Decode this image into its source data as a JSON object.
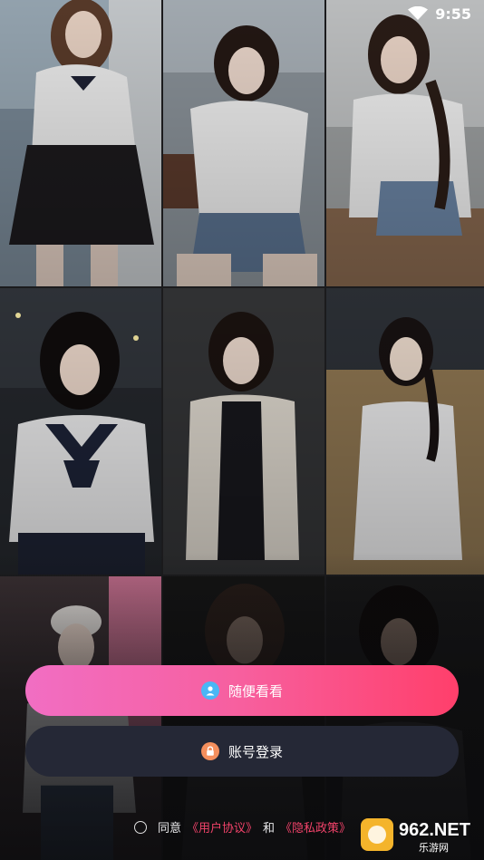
{
  "status_bar": {
    "time": "9:55",
    "wifi_icon": "wifi-icon",
    "battery_icon": "battery-icon"
  },
  "gallery": {
    "tiles": [
      {
        "name": "photo-tile-1",
        "palette": "bright"
      },
      {
        "name": "photo-tile-2",
        "palette": "bright"
      },
      {
        "name": "photo-tile-3",
        "palette": "bright"
      },
      {
        "name": "photo-tile-4",
        "palette": "night"
      },
      {
        "name": "photo-tile-5",
        "palette": "dark"
      },
      {
        "name": "photo-tile-6",
        "palette": "field"
      },
      {
        "name": "photo-tile-7",
        "palette": "pink"
      },
      {
        "name": "photo-tile-8",
        "palette": "dark"
      },
      {
        "name": "photo-tile-9",
        "palette": "dark"
      }
    ]
  },
  "actions": {
    "guest_button_label": "随便看看",
    "guest_icon": "user-icon",
    "login_button_label": "账号登录",
    "login_icon": "lock-icon"
  },
  "agreement": {
    "prefix": "同意",
    "user_agreement": "《用户协议》",
    "conjunction": "和",
    "privacy_policy": "《隐私政策》"
  },
  "watermark": {
    "brand": "962.NET",
    "sub": "乐游网"
  },
  "colors": {
    "gradient_start": "#f16ec3",
    "gradient_end": "#ff3f6b",
    "login_bg": "#252836",
    "link": "#f2436a"
  }
}
